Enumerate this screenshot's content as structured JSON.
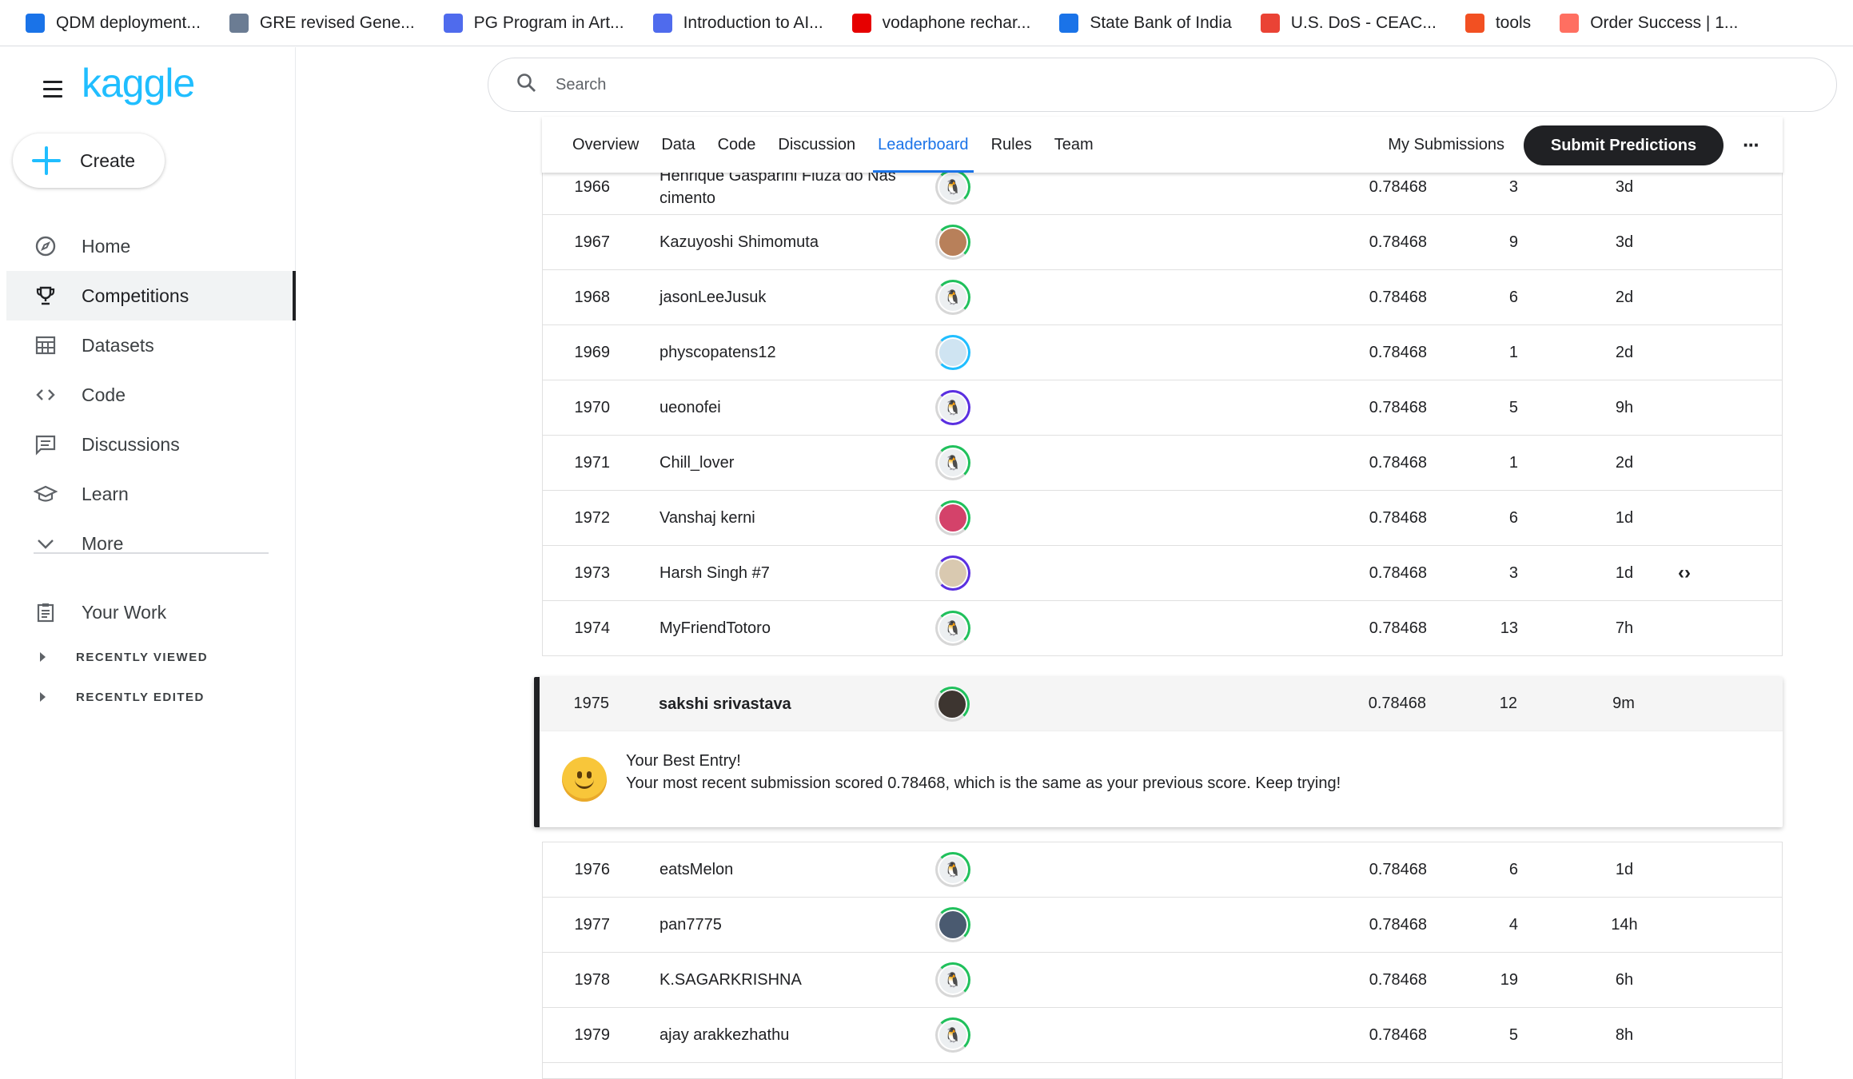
{
  "bookmarks": [
    {
      "label": "QDM deployment...",
      "icon": "att-globe-icon",
      "color": "#1a73e8"
    },
    {
      "label": "GRE revised Gene...",
      "icon": "ets-icon",
      "color": "#6b7c93"
    },
    {
      "label": "PG Program in Art...",
      "icon": "g-icon",
      "color": "#4f6bed"
    },
    {
      "label": "Introduction to AI...",
      "icon": "g-icon",
      "color": "#4f6bed"
    },
    {
      "label": "vodaphone rechar...",
      "icon": "vi-icon",
      "color": "#e60000"
    },
    {
      "label": "State Bank of India",
      "icon": "sbi-icon",
      "color": "#1a73e8"
    },
    {
      "label": "U.S. DoS - CEAC...",
      "icon": "gmail-icon",
      "color": "#ea4335"
    },
    {
      "label": "tools",
      "icon": "windows-grid-icon",
      "color": "#f25022"
    },
    {
      "label": "Order Success | 1...",
      "icon": "1mg-icon",
      "color": "#ff6f61"
    }
  ],
  "brand": {
    "logo": "kaggle",
    "accent": "#20beff"
  },
  "sidebar": {
    "create_label": "Create",
    "items": [
      {
        "label": "Home",
        "icon": "compass-icon"
      },
      {
        "label": "Competitions",
        "icon": "trophy-icon",
        "active": true
      },
      {
        "label": "Datasets",
        "icon": "table-icon"
      },
      {
        "label": "Code",
        "icon": "code-brackets-icon"
      },
      {
        "label": "Discussions",
        "icon": "comments-icon"
      },
      {
        "label": "Learn",
        "icon": "graduation-cap-icon"
      },
      {
        "label": "More",
        "icon": "chevron-down-icon"
      }
    ],
    "your_work": "Your Work",
    "recently_viewed": "RECENTLY VIEWED",
    "recently_edited": "RECENTLY EDITED"
  },
  "search": {
    "placeholder": "Search"
  },
  "tabs": {
    "items": [
      "Overview",
      "Data",
      "Code",
      "Discussion",
      "Leaderboard",
      "Rules",
      "Team"
    ],
    "active": "Leaderboard",
    "my_submissions": "My Submissions",
    "submit_label": "Submit Predictions",
    "more": "···"
  },
  "leaderboard_rows_before": [
    {
      "rank": "1966",
      "name": "Henrique Gasparini Fiuza do Nas cimento",
      "score": "0.78468",
      "entries": "3",
      "last": "3d",
      "avatar": "default",
      "ring": "green"
    },
    {
      "rank": "1967",
      "name": "Kazuyoshi Shimomuta",
      "score": "0.78468",
      "entries": "9",
      "last": "3d",
      "avatar": "photo1",
      "ring": "green"
    },
    {
      "rank": "1968",
      "name": "jasonLeeJusuk",
      "score": "0.78468",
      "entries": "6",
      "last": "2d",
      "avatar": "default",
      "ring": "green"
    },
    {
      "rank": "1969",
      "name": "physcopatens12",
      "score": "0.78468",
      "entries": "1",
      "last": "2d",
      "avatar": "photo6",
      "ring": "blue"
    },
    {
      "rank": "1970",
      "name": "ueonofei",
      "score": "0.78468",
      "entries": "5",
      "last": "9h",
      "avatar": "default",
      "ring": "purple"
    },
    {
      "rank": "1971",
      "name": "Chill_lover",
      "score": "0.78468",
      "entries": "1",
      "last": "2d",
      "avatar": "default",
      "ring": "green"
    },
    {
      "rank": "1972",
      "name": "Vanshaj kerni",
      "score": "0.78468",
      "entries": "6",
      "last": "1d",
      "avatar": "photo2",
      "ring": "green"
    },
    {
      "rank": "1973",
      "name": "Harsh Singh #7",
      "score": "0.78468",
      "entries": "3",
      "last": "1d",
      "avatar": "photo3",
      "ring": "purple",
      "code": "‹›"
    },
    {
      "rank": "1974",
      "name": "MyFriendTotoro",
      "score": "0.78468",
      "entries": "13",
      "last": "7h",
      "avatar": "default",
      "ring": "green"
    }
  ],
  "my_entry": {
    "rank": "1975",
    "name": "sakshi srivastava",
    "score": "0.78468",
    "entries": "12",
    "last": "9m",
    "best_title": "Your Best Entry!",
    "best_message": "Your most recent submission scored 0.78468, which is the same as your previous score. Keep trying!"
  },
  "leaderboard_rows_after": [
    {
      "rank": "1976",
      "name": "eatsMelon",
      "score": "0.78468",
      "entries": "6",
      "last": "1d",
      "avatar": "default",
      "ring": "green"
    },
    {
      "rank": "1977",
      "name": "pan7775",
      "score": "0.78468",
      "entries": "4",
      "last": "14h",
      "avatar": "photo5",
      "ring": "green"
    },
    {
      "rank": "1978",
      "name": "K.SAGARKRISHNA",
      "score": "0.78468",
      "entries": "19",
      "last": "6h",
      "avatar": "default",
      "ring": "green"
    },
    {
      "rank": "1979",
      "name": "ajay arakkezhathu",
      "score": "0.78468",
      "entries": "5",
      "last": "8h",
      "avatar": "default",
      "ring": "green"
    }
  ]
}
